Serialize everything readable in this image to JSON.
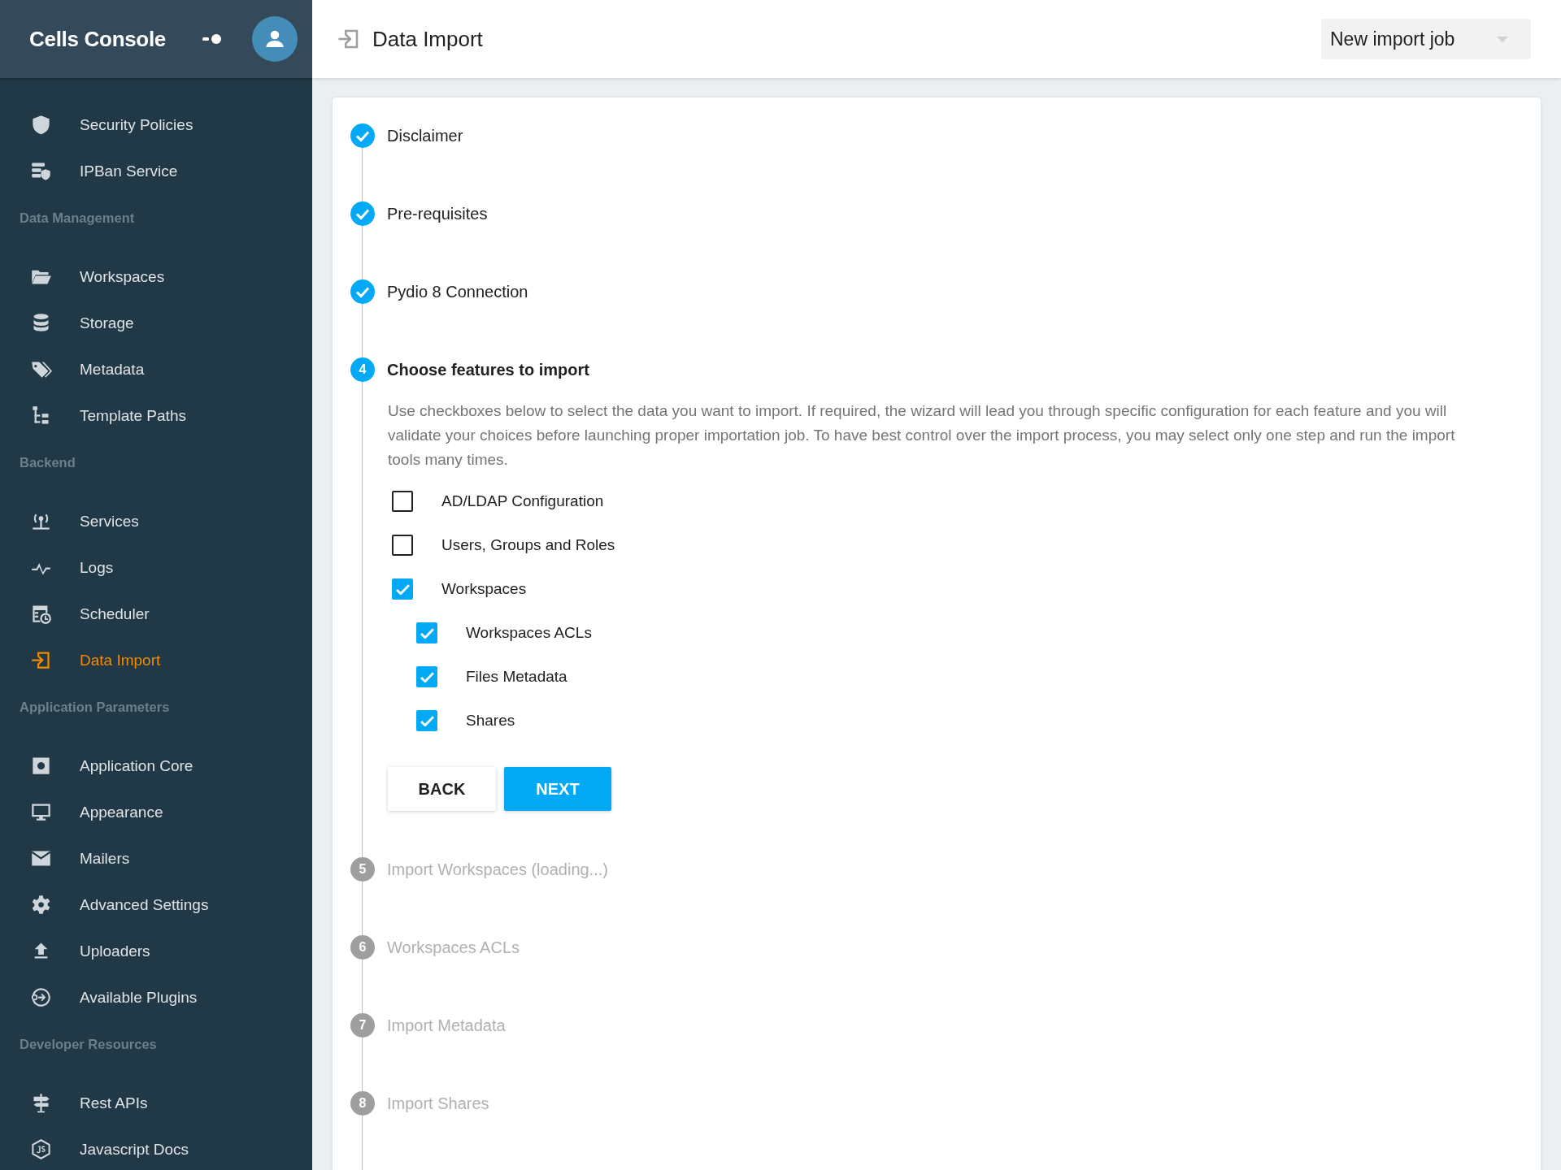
{
  "sidebar": {
    "title": "Cells Console",
    "sections": [
      {
        "items": [
          {
            "label": "Security Policies",
            "selected": false
          },
          {
            "label": "IPBan Service",
            "selected": false
          }
        ]
      },
      {
        "heading": "Data Management",
        "items": [
          {
            "label": "Workspaces",
            "selected": false
          },
          {
            "label": "Storage",
            "selected": false
          },
          {
            "label": "Metadata",
            "selected": false
          },
          {
            "label": "Template Paths",
            "selected": false
          }
        ]
      },
      {
        "heading": "Backend",
        "items": [
          {
            "label": "Services",
            "selected": false
          },
          {
            "label": "Logs",
            "selected": false
          },
          {
            "label": "Scheduler",
            "selected": false
          },
          {
            "label": "Data Import",
            "selected": true
          }
        ]
      },
      {
        "heading": "Application Parameters",
        "items": [
          {
            "label": "Application Core",
            "selected": false
          },
          {
            "label": "Appearance",
            "selected": false
          },
          {
            "label": "Mailers",
            "selected": false
          },
          {
            "label": "Advanced Settings",
            "selected": false
          },
          {
            "label": "Uploaders",
            "selected": false
          },
          {
            "label": "Available Plugins",
            "selected": false
          }
        ]
      },
      {
        "heading": "Developer Resources",
        "items": [
          {
            "label": "Rest APIs",
            "selected": false
          },
          {
            "label": "Javascript Docs",
            "selected": false
          }
        ]
      }
    ]
  },
  "header": {
    "title": "Data Import",
    "dropdown": {
      "value": "New import job"
    }
  },
  "steps": [
    {
      "label": "Disclaimer",
      "completed": true,
      "active": false
    },
    {
      "label": "Pre-requisites",
      "completed": true,
      "active": false
    },
    {
      "label": "Pydio 8 Connection",
      "completed": true,
      "active": false
    },
    {
      "number": "4",
      "label": "Choose features to import",
      "completed": false,
      "active": true,
      "description": "Use checkboxes below to select the data you want to import. If required, the wizard will lead you through specific configuration for each feature and you will validate your choices before launching proper importation job. To have best control over the import process, you may select only one step and run the import tools many times.",
      "options": [
        {
          "label": "AD/LDAP Configuration",
          "checked": false
        },
        {
          "label": "Users, Groups and Roles",
          "checked": false
        },
        {
          "label": "Workspaces",
          "checked": true,
          "children": [
            {
              "label": "Workspaces ACLs",
              "checked": true
            },
            {
              "label": "Files Metadata",
              "checked": true
            },
            {
              "label": "Shares",
              "checked": true
            }
          ]
        }
      ],
      "buttons": [
        {
          "label": "BACK",
          "kind": "secondary"
        },
        {
          "label": "NEXT",
          "kind": "primary"
        }
      ]
    },
    {
      "number": "5",
      "label": "Import Workspaces (loading...)",
      "completed": false,
      "active": false
    },
    {
      "number": "6",
      "label": "Workspaces ACLs",
      "completed": false,
      "active": false
    },
    {
      "number": "7",
      "label": "Import Metadata",
      "completed": false,
      "active": false
    },
    {
      "number": "8",
      "label": "Import Shares",
      "completed": false,
      "active": false
    }
  ]
}
